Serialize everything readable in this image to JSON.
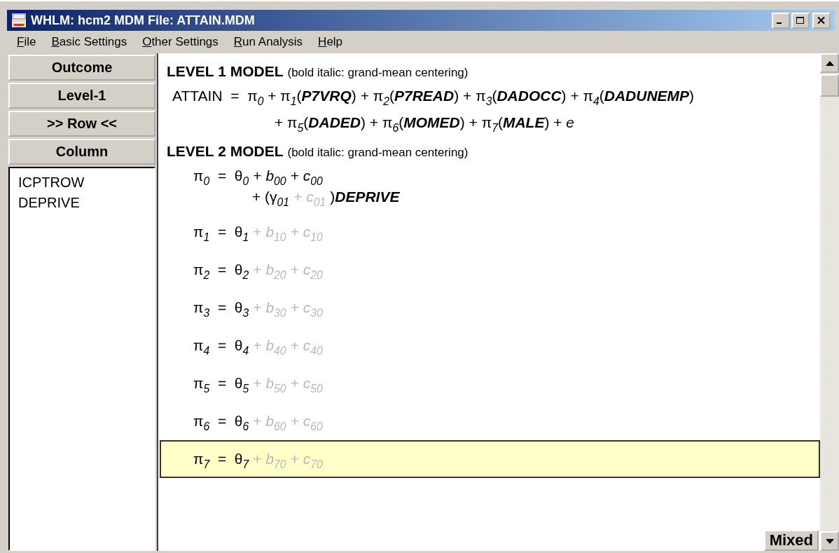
{
  "window": {
    "title": "WHLM: hcm2 MDM File: ATTAIN.MDM"
  },
  "menu": [
    "File",
    "Basic Settings",
    "Other Settings",
    "Run Analysis",
    "Help"
  ],
  "sidebar": {
    "buttons": [
      "Outcome",
      "Level-1",
      ">> Row <<",
      "Column"
    ],
    "variables": [
      "ICPTROW",
      "DEPRIVE"
    ]
  },
  "level1": {
    "heading": "LEVEL 1 MODEL",
    "note": "(bold italic: grand-mean centering)",
    "lines": [
      "ATTAIN  =  π$_{0}$ + π$_{1}$(**P7VRQ**) + π$_{2}$(**P7READ**) + π$_{3}$(**DADOCC**) + π$_{4}$(**DADUNEMP**)",
      "+ π$_{5}$(**DADED**) + π$_{6}$(**MOMED**) + π$_{7}$(**MALE**) + *e*"
    ]
  },
  "level2": {
    "heading": "LEVEL 2 MODEL",
    "note": "(bold italic: grand-mean centering)",
    "rows": [
      {
        "selected": false,
        "lines": [
          [
            {
              "text": "π$_{0}$  =  θ$_{0}$",
              "active": true
            },
            {
              "text": "+ *b*$_{00}$",
              "active": true
            },
            {
              "text": "+ *c*$_{00}$",
              "active": true
            }
          ],
          [
            {
              "text": "+ (γ$_{01}$",
              "active": true
            },
            {
              "text": "+ *c*$_{01}$",
              "active": false
            },
            {
              "text": ")**DEPRIVE**",
              "active": true
            }
          ]
        ]
      },
      {
        "selected": false,
        "lines": [
          [
            {
              "text": "π$_{1}$  =  θ$_{1}$",
              "active": true
            },
            {
              "text": "+ *b*$_{10}$",
              "active": false
            },
            {
              "text": "+ *c*$_{10}$",
              "active": false
            }
          ]
        ]
      },
      {
        "selected": false,
        "lines": [
          [
            {
              "text": "π$_{2}$  =  θ$_{2}$",
              "active": true
            },
            {
              "text": "+ *b*$_{20}$",
              "active": false
            },
            {
              "text": "+ *c*$_{20}$",
              "active": false
            }
          ]
        ]
      },
      {
        "selected": false,
        "lines": [
          [
            {
              "text": "π$_{3}$  =  θ$_{3}$",
              "active": true
            },
            {
              "text": "+ *b*$_{30}$",
              "active": false
            },
            {
              "text": "+ *c*$_{30}$",
              "active": false
            }
          ]
        ]
      },
      {
        "selected": false,
        "lines": [
          [
            {
              "text": "π$_{4}$  =  θ$_{4}$",
              "active": true
            },
            {
              "text": "+ *b*$_{40}$",
              "active": false
            },
            {
              "text": "+ *c*$_{40}$",
              "active": false
            }
          ]
        ]
      },
      {
        "selected": false,
        "lines": [
          [
            {
              "text": "π$_{5}$  =  θ$_{5}$",
              "active": true
            },
            {
              "text": "+ *b*$_{50}$",
              "active": false
            },
            {
              "text": "+ *c*$_{50}$",
              "active": false
            }
          ]
        ]
      },
      {
        "selected": false,
        "lines": [
          [
            {
              "text": "π$_{6}$  =  θ$_{6}$",
              "active": true
            },
            {
              "text": "+ *b*$_{60}$",
              "active": false
            },
            {
              "text": "+ *c*$_{60}$",
              "active": false
            }
          ]
        ]
      },
      {
        "selected": true,
        "lines": [
          [
            {
              "text": "π$_{7}$  =  θ$_{7}$",
              "active": true
            },
            {
              "text": "+ *b*$_{70}$",
              "active": false
            },
            {
              "text": "+ *c*$_{70}$",
              "active": false
            }
          ]
        ]
      }
    ]
  },
  "mode_button": "Mixed"
}
